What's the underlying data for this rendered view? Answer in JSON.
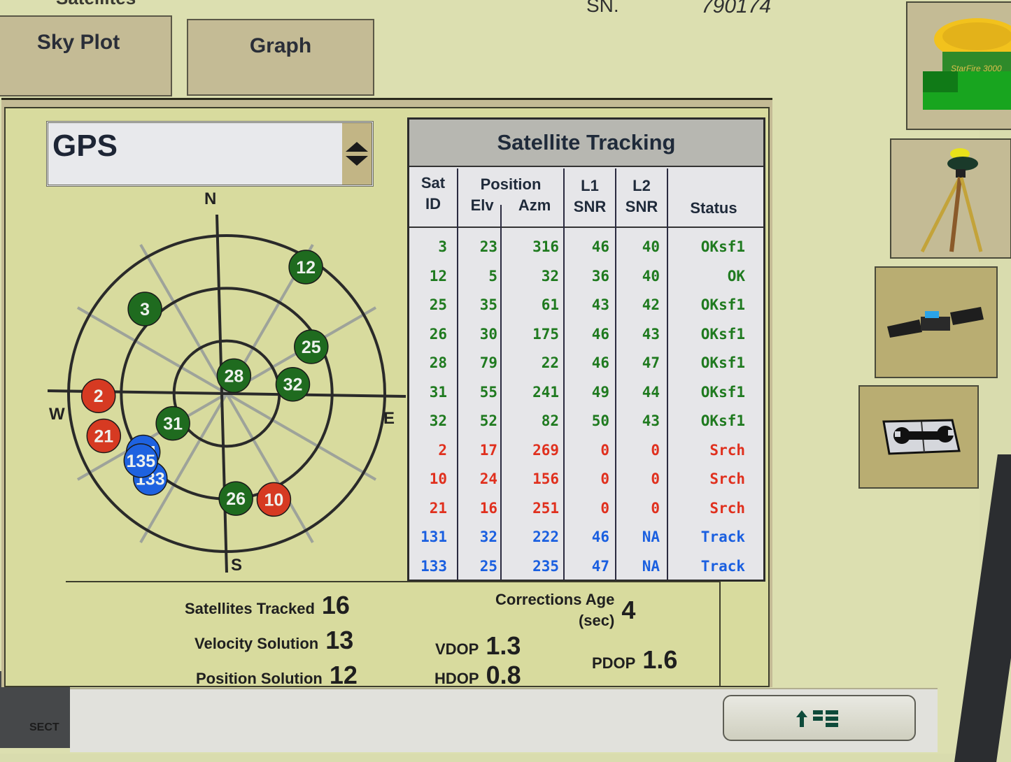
{
  "header": {
    "title_fragment": "Satellites",
    "serial_label": "SN.",
    "serial_value": "790174"
  },
  "tabs": [
    {
      "label": "Sky Plot",
      "active": true
    },
    {
      "label": "Graph",
      "active": false
    }
  ],
  "constellation_select": {
    "value": "GPS"
  },
  "skyplot": {
    "compass": {
      "n": "N",
      "e": "E",
      "s": "S",
      "w": "W"
    },
    "elevation_rings_deg": [
      0,
      30,
      60
    ],
    "colors": {
      "ok": "#1f6b1f",
      "search": "#d63a22",
      "track": "#1e62e0"
    },
    "satellites": [
      {
        "id": "3",
        "elv": 23,
        "azm": 316,
        "status": "ok"
      },
      {
        "id": "12",
        "elv": 5,
        "azm": 32,
        "status": "ok"
      },
      {
        "id": "25",
        "elv": 35,
        "azm": 61,
        "status": "ok"
      },
      {
        "id": "26",
        "elv": 30,
        "azm": 175,
        "status": "ok"
      },
      {
        "id": "28",
        "elv": 79,
        "azm": 22,
        "status": "ok"
      },
      {
        "id": "31",
        "elv": 55,
        "azm": 241,
        "status": "ok"
      },
      {
        "id": "32",
        "elv": 52,
        "azm": 82,
        "status": "ok"
      },
      {
        "id": "2",
        "elv": 17,
        "azm": 269,
        "status": "search"
      },
      {
        "id": "10",
        "elv": 24,
        "azm": 156,
        "status": "search"
      },
      {
        "id": "21",
        "elv": 16,
        "azm": 251,
        "status": "search"
      },
      {
        "id": "131",
        "elv": 32,
        "azm": 235,
        "status": "track"
      },
      {
        "id": "133",
        "elv": 25,
        "azm": 222,
        "status": "track"
      },
      {
        "id": "135",
        "elv": 28,
        "azm": 232,
        "status": "track"
      }
    ]
  },
  "table": {
    "title": "Satellite Tracking",
    "headers": {
      "sat_id_1": "Sat",
      "sat_id_2": "ID",
      "position": "Position",
      "elv": "Elv",
      "azm": "Azm",
      "l1_1": "L1",
      "l1_2": "SNR",
      "l2_1": "L2",
      "l2_2": "SNR",
      "status": "Status"
    },
    "rows": [
      {
        "id": "3",
        "elv": "23",
        "azm": "316",
        "l1": "46",
        "l2": "40",
        "status": "OKsf1",
        "color": "#1f7a1f"
      },
      {
        "id": "12",
        "elv": "5",
        "azm": "32",
        "l1": "36",
        "l2": "40",
        "status": "OK",
        "color": "#1f7a1f"
      },
      {
        "id": "25",
        "elv": "35",
        "azm": "61",
        "l1": "43",
        "l2": "42",
        "status": "OKsf1",
        "color": "#1f7a1f"
      },
      {
        "id": "26",
        "elv": "30",
        "azm": "175",
        "l1": "46",
        "l2": "43",
        "status": "OKsf1",
        "color": "#1f7a1f"
      },
      {
        "id": "28",
        "elv": "79",
        "azm": "22",
        "l1": "46",
        "l2": "47",
        "status": "OKsf1",
        "color": "#1f7a1f"
      },
      {
        "id": "31",
        "elv": "55",
        "azm": "241",
        "l1": "49",
        "l2": "44",
        "status": "OKsf1",
        "color": "#1f7a1f"
      },
      {
        "id": "32",
        "elv": "52",
        "azm": "82",
        "l1": "50",
        "l2": "43",
        "status": "OKsf1",
        "color": "#1f7a1f"
      },
      {
        "id": "2",
        "elv": "17",
        "azm": "269",
        "l1": "0",
        "l2": "0",
        "status": "Srch",
        "color": "#e0301e"
      },
      {
        "id": "10",
        "elv": "24",
        "azm": "156",
        "l1": "0",
        "l2": "0",
        "status": "Srch",
        "color": "#e0301e"
      },
      {
        "id": "21",
        "elv": "16",
        "azm": "251",
        "l1": "0",
        "l2": "0",
        "status": "Srch",
        "color": "#e0301e"
      },
      {
        "id": "131",
        "elv": "32",
        "azm": "222",
        "l1": "46",
        "l2": "NA",
        "status": "Track",
        "color": "#1a5fe0"
      },
      {
        "id": "133",
        "elv": "25",
        "azm": "235",
        "l1": "47",
        "l2": "NA",
        "status": "Track",
        "color": "#1a5fe0"
      }
    ]
  },
  "stats": {
    "satellites_tracked": {
      "label": "Satellites Tracked",
      "value": "16"
    },
    "velocity_solution": {
      "label": "Velocity Solution",
      "value": "13"
    },
    "position_solution": {
      "label": "Position Solution",
      "value": "12"
    },
    "vdop": {
      "label": "VDOP",
      "value": "1.3"
    },
    "hdop": {
      "label": "HDOP",
      "value": "0.8"
    },
    "pdop": {
      "label": "PDOP",
      "value": "1.6"
    },
    "corrections_age": {
      "label": "Corrections Age",
      "unit": "(sec)",
      "value": "4"
    }
  },
  "side_buttons": [
    {
      "icon": "receiver-icon"
    },
    {
      "icon": "tripod-base-station-icon"
    },
    {
      "icon": "satellite-icon"
    },
    {
      "icon": "manual-wrench-icon"
    }
  ],
  "background": {
    "left_tab_fragment": "SECT"
  }
}
